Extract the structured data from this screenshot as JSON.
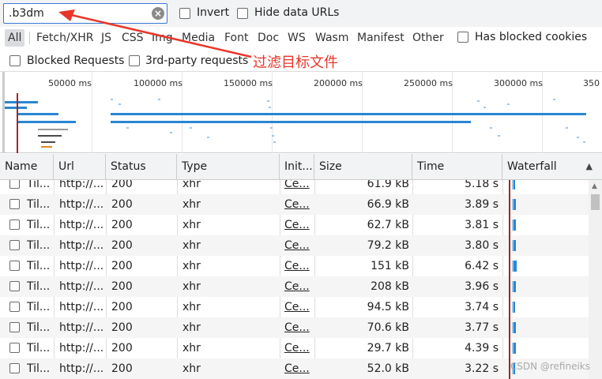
{
  "toolbar": {
    "filter_value": ".b3dm",
    "invert_label": "Invert",
    "hide_data_urls_label": "Hide data URLs"
  },
  "type_filters": [
    "All",
    "Fetch/XHR",
    "JS",
    "CSS",
    "Img",
    "Media",
    "Font",
    "Doc",
    "WS",
    "Wasm",
    "Manifest",
    "Other"
  ],
  "has_blocked_cookies_label": "Has blocked cookies",
  "blocked_requests_label": "Blocked Requests",
  "third_party_label": "3rd-party requests",
  "annotation": "过滤目标文件",
  "overview": {
    "ticks": [
      "50000 ms",
      "100000 ms",
      "150000 ms",
      "200000 ms",
      "250000 ms",
      "300000 ms",
      "350"
    ]
  },
  "columns": [
    "Name",
    "Url",
    "Status",
    "Type",
    "Init...",
    "Size",
    "Time",
    "Waterfall"
  ],
  "rows": [
    {
      "name": "Til...",
      "url": "http://...",
      "status": "200",
      "type": "xhr",
      "initiator": "Ce...",
      "size": "61.9 kB",
      "time": "5.18 s"
    },
    {
      "name": "Til...",
      "url": "http://...",
      "status": "200",
      "type": "xhr",
      "initiator": "Ce...",
      "size": "66.9 kB",
      "time": "3.89 s"
    },
    {
      "name": "Til...",
      "url": "http://...",
      "status": "200",
      "type": "xhr",
      "initiator": "Ce...",
      "size": "62.7 kB",
      "time": "3.81 s"
    },
    {
      "name": "Til...",
      "url": "http://...",
      "status": "200",
      "type": "xhr",
      "initiator": "Ce...",
      "size": "79.2 kB",
      "time": "3.80 s"
    },
    {
      "name": "Til...",
      "url": "http://...",
      "status": "200",
      "type": "xhr",
      "initiator": "Ce...",
      "size": "151 kB",
      "time": "6.42 s"
    },
    {
      "name": "Til...",
      "url": "http://...",
      "status": "200",
      "type": "xhr",
      "initiator": "Ce...",
      "size": "208 kB",
      "time": "3.96 s"
    },
    {
      "name": "Til...",
      "url": "http://...",
      "status": "200",
      "type": "xhr",
      "initiator": "Ce...",
      "size": "94.5 kB",
      "time": "3.74 s"
    },
    {
      "name": "Til...",
      "url": "http://...",
      "status": "200",
      "type": "xhr",
      "initiator": "Ce...",
      "size": "70.6 kB",
      "time": "3.77 s"
    },
    {
      "name": "Til...",
      "url": "http://...",
      "status": "200",
      "type": "xhr",
      "initiator": "Ce...",
      "size": "29.7 kB",
      "time": "4.39 s"
    },
    {
      "name": "Til...",
      "url": "http://...",
      "status": "200",
      "type": "xhr",
      "initiator": "Ce...",
      "size": "52.0 kB",
      "time": "3.22 s"
    }
  ],
  "watermark": "CSDN @refineiks",
  "colors": {
    "accent": "#3b79d8",
    "annotation": "#e8362a",
    "waterfall_bar": "#2a86d1",
    "marker_line": "#a02828"
  }
}
